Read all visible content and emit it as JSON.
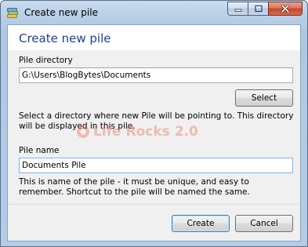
{
  "window": {
    "title": "Create new pile"
  },
  "header": {
    "title": "Create new pile"
  },
  "directory": {
    "label": "Pile directory",
    "value": "G:\\Users\\BlogBytes\\Documents",
    "select_label": "Select",
    "description": "Select a directory where new Pile will be pointing to. This directory will be displayed in this pile."
  },
  "name": {
    "label": "Pile name",
    "value": "Documents Pile",
    "description": "This is name of the pile - it must be unique, and easy to remember. Shortcut to the pile will be named the same."
  },
  "watermark": {
    "text": "Life Rocks 2.0"
  },
  "footer": {
    "create_label": "Create",
    "cancel_label": "Cancel"
  },
  "colors": {
    "heading": "#1f3f9a",
    "close_button": "#c7462a"
  }
}
